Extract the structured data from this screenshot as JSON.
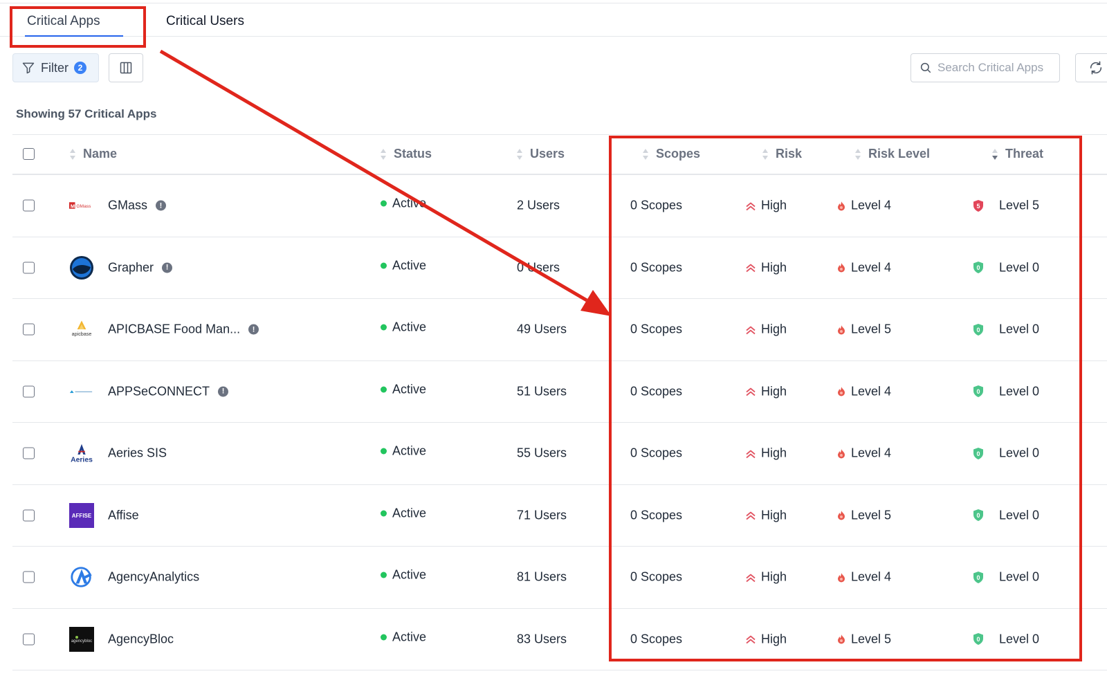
{
  "tabs": [
    {
      "label": "Critical Apps",
      "active": true
    },
    {
      "label": "Critical Users",
      "active": false
    }
  ],
  "toolbar": {
    "filter_label": "Filter",
    "filter_count": "2",
    "search_placeholder": "Search Critical Apps"
  },
  "summary": "Showing 57 Critical Apps",
  "columns": {
    "name": "Name",
    "status": "Status",
    "users": "Users",
    "scopes": "Scopes",
    "risk": "Risk",
    "risk_level": "Risk Level",
    "threat": "Threat"
  },
  "rows": [
    {
      "logo": "gmass-logo",
      "name": "GMass",
      "info": "!",
      "status": "Active",
      "users": "2 Users",
      "scopes": "0 Scopes",
      "risk": "High",
      "risk_level": "Level 4",
      "threat": "Level 5",
      "threat_icon": "5"
    },
    {
      "logo": "grapher-logo",
      "name": "Grapher",
      "info": "!",
      "status": "Active",
      "users": "0 Users",
      "scopes": "0 Scopes",
      "risk": "High",
      "risk_level": "Level 4",
      "threat": "Level 0",
      "threat_icon": "0"
    },
    {
      "logo": "apicbase-logo",
      "name": "APICBASE Food Man...",
      "info": "!",
      "status": "Active",
      "users": "49 Users",
      "scopes": "0 Scopes",
      "risk": "High",
      "risk_level": "Level 5",
      "threat": "Level 0",
      "threat_icon": "0"
    },
    {
      "logo": "appseconnect-logo",
      "name": "APPSeCONNECT",
      "info": "!",
      "status": "Active",
      "users": "51 Users",
      "scopes": "0 Scopes",
      "risk": "High",
      "risk_level": "Level 4",
      "threat": "Level 0",
      "threat_icon": "0"
    },
    {
      "logo": "aeries-logo",
      "name": "Aeries SIS",
      "info": "",
      "status": "Active",
      "users": "55 Users",
      "scopes": "0 Scopes",
      "risk": "High",
      "risk_level": "Level 4",
      "threat": "Level 0",
      "threat_icon": "0"
    },
    {
      "logo": "affise-logo",
      "name": "Affise",
      "info": "",
      "status": "Active",
      "users": "71 Users",
      "scopes": "0 Scopes",
      "risk": "High",
      "risk_level": "Level 5",
      "threat": "Level 0",
      "threat_icon": "0"
    },
    {
      "logo": "agencyanalytics-logo",
      "name": "AgencyAnalytics",
      "info": "",
      "status": "Active",
      "users": "81 Users",
      "scopes": "0 Scopes",
      "risk": "High",
      "risk_level": "Level 4",
      "threat": "Level 0",
      "threat_icon": "0"
    },
    {
      "logo": "agencybloc-logo",
      "name": "AgencyBloc",
      "info": "",
      "status": "Active",
      "users": "83 Users",
      "scopes": "0 Scopes",
      "risk": "High",
      "risk_level": "Level 5",
      "threat": "Level 0",
      "threat_icon": "0"
    }
  ],
  "logo_text": {
    "gmass": "GMass",
    "apicbase": "apicbase",
    "aeries": "Aeries",
    "affise": "AFFISE",
    "agencybloc": "agencybloc"
  },
  "colors": {
    "accent": "#2563eb",
    "status_active": "#22c55e",
    "risk_high": "#e25563",
    "threat_high": "#e2465a",
    "threat_low": "#4cc58a",
    "annotation": "#e0261c"
  }
}
